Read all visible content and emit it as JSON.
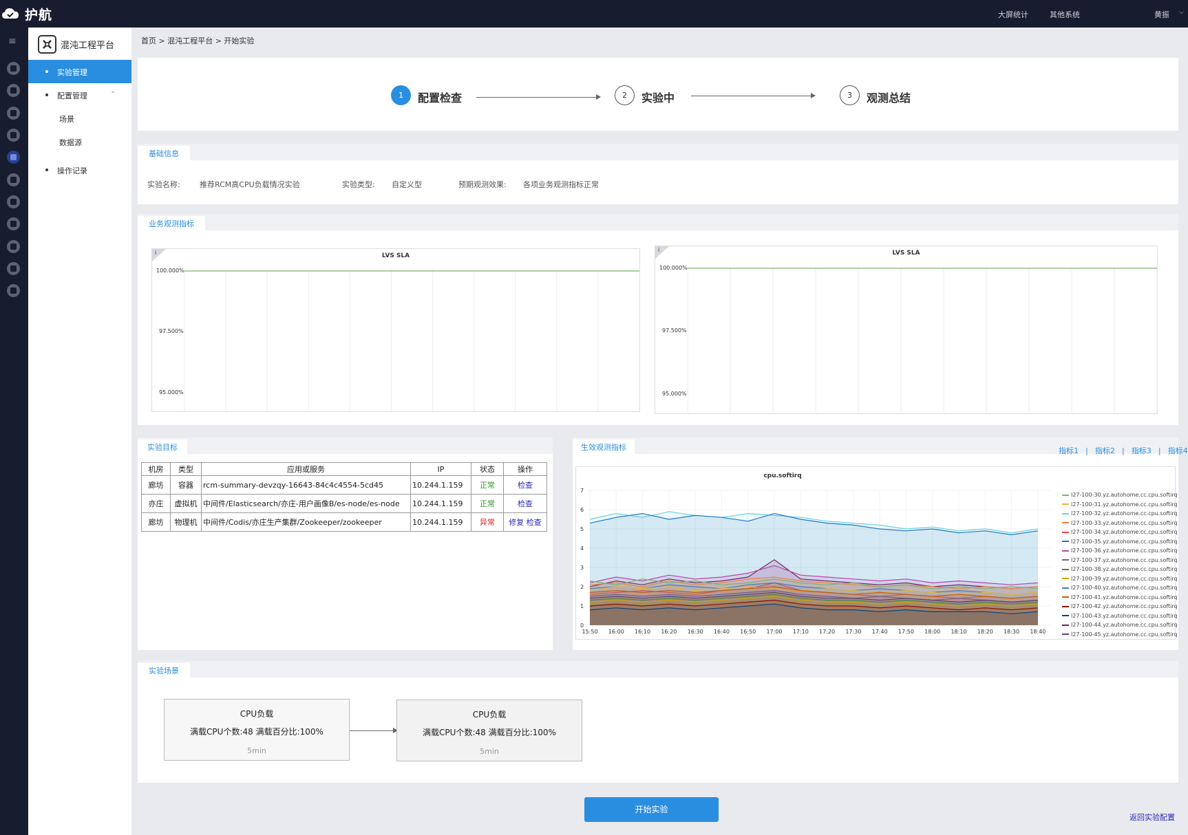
{
  "app": {
    "name": "护航",
    "top_links": [
      "大屏统计",
      "其他系统"
    ],
    "user": "黄振"
  },
  "sidebar": {
    "platform_title": "混沌工程平台",
    "items": [
      {
        "label": "实验管理",
        "active": true
      },
      {
        "label": "配置管理",
        "expanded": true,
        "children": [
          "场景",
          "数据源"
        ]
      },
      {
        "label": "操作记录"
      }
    ]
  },
  "breadcrumb": "首页 > 混沌工程平台 > 开始实验",
  "steps": [
    {
      "num": "1",
      "label": "配置检查",
      "active": true
    },
    {
      "num": "2",
      "label": "实验中"
    },
    {
      "num": "3",
      "label": "观测总结"
    }
  ],
  "basic_info": {
    "tab": "基础信息",
    "name_label": "实验名称:",
    "name": "推荐RCM高CPU负载情况实验",
    "type_label": "实验类型:",
    "type": "自定义型",
    "effect_label": "预期观测效果:",
    "effect": "各项业务观测指标正常"
  },
  "business_metrics": {
    "tab": "业务观测指标",
    "charts": [
      {
        "info": "i",
        "title": "LVS SLA",
        "yticks": [
          "100.000%",
          "97.500%",
          "95.000%"
        ]
      },
      {
        "info": "i",
        "title": "LVS SLA",
        "yticks": [
          "100.000%",
          "97.500%",
          "95.000%"
        ]
      }
    ]
  },
  "targets": {
    "tab": "实验目标",
    "columns": [
      "机房",
      "类型",
      "应用或服务",
      "IP",
      "状态",
      "操作"
    ],
    "rows": [
      {
        "room": "廊坊",
        "type": "容器",
        "service": "rcm-summary-devzqy-16643-84c4c4554-5cd45",
        "ip": "10.244.1.159",
        "status": "正常",
        "ops": [
          "检查"
        ]
      },
      {
        "room": "亦庄",
        "type": "虚拟机",
        "service": "中间件/Elasticsearch/亦庄-用户画像B/es-node/es-node",
        "ip": "10.244.1.159",
        "status": "正常",
        "ops": [
          "检查"
        ]
      },
      {
        "room": "廊坊",
        "type": "物理机",
        "service": "中间件/Codis/亦庄生产集群/Zookeeper/zookeeper",
        "ip": "10.244.1.159",
        "status": "异常",
        "ops": [
          "修复",
          "检查"
        ]
      }
    ]
  },
  "effect_metrics": {
    "tab": "生效观测指标",
    "links": [
      "指标1",
      "指标2",
      "指标3",
      "指标4"
    ],
    "separator": "|"
  },
  "chart_data": {
    "type": "area",
    "title": "cpu.softirq",
    "x": [
      "15:50",
      "16:00",
      "16:10",
      "16:20",
      "16:30",
      "16:40",
      "16:50",
      "17:00",
      "17:10",
      "17:20",
      "17:30",
      "17:40",
      "17:50",
      "18:00",
      "18:10",
      "18:20",
      "18:30",
      "18:40"
    ],
    "ylim": [
      0,
      7
    ],
    "yticks": [
      "0",
      "1",
      "2",
      "3",
      "4",
      "5",
      "6",
      "7"
    ],
    "series": [
      {
        "name": "l27-100-30.yz.autohome.cc.cpu.softirq",
        "color": "#7eb26d",
        "values": [
          2.3,
          2.1,
          2.4,
          2.2,
          2.3,
          2.1,
          2.2,
          2.4,
          2.2,
          2.1,
          2.2,
          2.0,
          2.1,
          1.9,
          2.0,
          1.9,
          2.0,
          1.9
        ]
      },
      {
        "name": "l27-100-31.yz.autohome.cc.cpu.softirq",
        "color": "#eab839",
        "values": [
          1.8,
          2.0,
          1.9,
          2.0,
          1.8,
          1.9,
          2.0,
          1.9,
          1.8,
          1.9,
          1.8,
          1.7,
          1.8,
          1.7,
          1.6,
          1.7,
          1.6,
          1.7
        ]
      },
      {
        "name": "l27-100-32.yz.autohome.cc.cpu.softirq",
        "color": "#6ed0e0",
        "values": [
          5.5,
          5.8,
          5.6,
          5.9,
          5.7,
          5.6,
          5.8,
          5.7,
          5.6,
          5.4,
          5.3,
          5.2,
          5.0,
          5.1,
          4.9,
          5.0,
          4.8,
          5.0
        ]
      },
      {
        "name": "l27-100-33.yz.autohome.cc.cpu.softirq",
        "color": "#ef843c",
        "values": [
          2.1,
          2.2,
          2.0,
          2.3,
          2.1,
          2.2,
          2.4,
          2.5,
          2.3,
          2.2,
          2.1,
          2.0,
          2.1,
          2.0,
          1.9,
          2.0,
          1.9,
          2.0
        ]
      },
      {
        "name": "l27-100-34.yz.autohome.cc.cpu.softirq",
        "color": "#e24d42",
        "values": [
          1.6,
          1.7,
          1.8,
          1.7,
          1.6,
          1.8,
          1.9,
          2.2,
          1.8,
          1.7,
          1.6,
          1.5,
          1.6,
          1.5,
          1.4,
          1.5,
          1.4,
          1.5
        ]
      },
      {
        "name": "l27-100-35.yz.autohome.cc.cpu.softirq",
        "color": "#1f78c1",
        "values": [
          5.3,
          5.6,
          5.8,
          5.5,
          5.7,
          5.6,
          5.4,
          5.8,
          5.5,
          5.3,
          5.2,
          5.0,
          4.9,
          5.0,
          4.8,
          4.9,
          4.7,
          4.9
        ]
      },
      {
        "name": "l27-100-36.yz.autohome.cc.cpu.softirq",
        "color": "#ba43a9",
        "values": [
          2.2,
          2.5,
          2.3,
          2.6,
          2.4,
          2.5,
          2.7,
          3.1,
          2.6,
          2.5,
          2.4,
          2.3,
          2.4,
          2.2,
          2.3,
          2.2,
          2.1,
          2.2
        ]
      },
      {
        "name": "l27-100-37.yz.autohome.cc.cpu.softirq",
        "color": "#705da0",
        "values": [
          1.5,
          1.6,
          1.5,
          1.6,
          1.5,
          1.6,
          1.7,
          1.8,
          1.6,
          1.5,
          1.4,
          1.5,
          1.4,
          1.3,
          1.4,
          1.3,
          1.2,
          1.3
        ]
      },
      {
        "name": "l27-100-38.yz.autohome.cc.cpu.softirq",
        "color": "#508642",
        "values": [
          1.3,
          1.4,
          1.3,
          1.4,
          1.3,
          1.4,
          1.5,
          1.6,
          1.4,
          1.3,
          1.3,
          1.2,
          1.3,
          1.2,
          1.1,
          1.2,
          1.1,
          1.2
        ]
      },
      {
        "name": "l27-100-39.yz.autohome.cc.cpu.softirq",
        "color": "#cca300",
        "values": [
          1.2,
          1.3,
          1.2,
          1.3,
          1.2,
          1.3,
          1.4,
          1.5,
          1.3,
          1.2,
          1.2,
          1.1,
          1.2,
          1.1,
          1.0,
          1.1,
          1.0,
          1.1
        ]
      },
      {
        "name": "l27-100-40.yz.autohome.cc.cpu.softirq",
        "color": "#447ebc",
        "values": [
          1.9,
          2.0,
          1.9,
          2.1,
          2.0,
          1.9,
          2.1,
          2.2,
          2.0,
          1.9,
          1.8,
          1.9,
          1.8,
          1.7,
          1.8,
          1.7,
          1.6,
          1.7
        ]
      },
      {
        "name": "l27-100-41.yz.autohome.cc.cpu.softirq",
        "color": "#c15c17",
        "values": [
          1.7,
          1.8,
          1.7,
          1.8,
          1.7,
          1.8,
          1.9,
          2.0,
          1.8,
          1.7,
          1.6,
          1.7,
          1.6,
          1.5,
          1.6,
          1.5,
          1.4,
          1.5
        ]
      },
      {
        "name": "l27-100-42.yz.autohome.cc.cpu.softirq",
        "color": "#890f02",
        "values": [
          1.0,
          1.1,
          1.0,
          1.1,
          1.0,
          1.1,
          1.2,
          1.3,
          1.1,
          1.0,
          1.0,
          0.9,
          1.0,
          0.9,
          0.8,
          0.9,
          0.8,
          0.9
        ]
      },
      {
        "name": "l27-100-43.yz.autohome.cc.cpu.softirq",
        "color": "#0a437c",
        "values": [
          0.8,
          0.9,
          0.8,
          0.9,
          0.8,
          0.9,
          1.0,
          1.1,
          0.9,
          0.8,
          0.8,
          0.7,
          0.8,
          0.7,
          0.7,
          0.7,
          0.6,
          0.7
        ]
      },
      {
        "name": "l27-100-44.yz.autohome.cc.cpu.softirq",
        "color": "#6d1f62",
        "values": [
          2.0,
          2.3,
          2.1,
          2.4,
          2.2,
          2.3,
          2.5,
          3.4,
          2.4,
          2.3,
          2.2,
          2.1,
          2.2,
          2.0,
          2.1,
          2.0,
          1.9,
          2.0
        ]
      },
      {
        "name": "l27-100-45.yz.autohome.cc.cpu.softirq",
        "color": "#584477",
        "values": [
          1.4,
          1.5,
          1.4,
          1.5,
          1.4,
          1.5,
          1.6,
          1.7,
          1.5,
          1.4,
          1.4,
          1.3,
          1.4,
          1.3,
          1.2,
          1.3,
          1.2,
          1.3
        ]
      }
    ]
  },
  "scenario": {
    "tab": "实验场景",
    "boxes": [
      {
        "title": "CPU负载",
        "desc": "满载CPU个数:48  满载百分比:100%",
        "duration": "5min"
      },
      {
        "title": "CPU负载",
        "desc": "满载CPU个数:48  满载百分比:100%",
        "duration": "5min"
      }
    ]
  },
  "actions": {
    "start": "开始实验",
    "back": "返回实验配置"
  }
}
